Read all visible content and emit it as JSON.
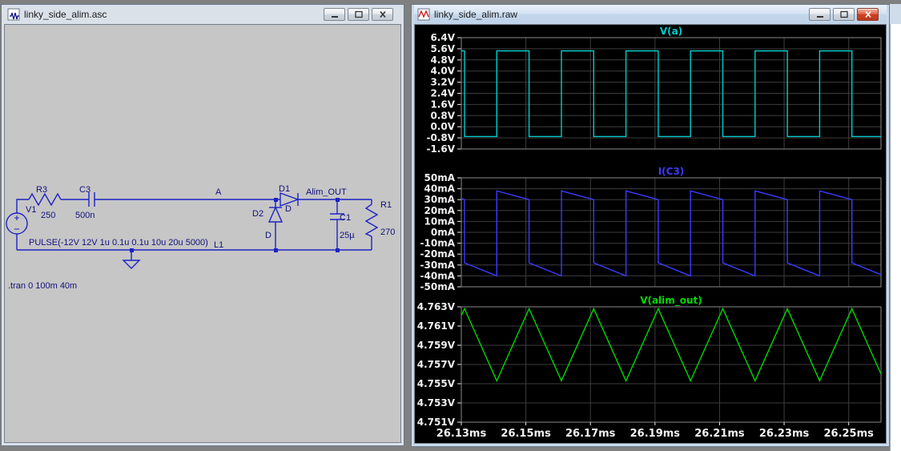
{
  "desktop": {
    "background": "#808080"
  },
  "schematic_window": {
    "title": "linky_side_alim.asc",
    "components": {
      "v1_name": "V1",
      "r3_name": "R3",
      "r3_value": "250",
      "c3_name": "C3",
      "c3_value": "500n",
      "node_a": "A",
      "d2_name": "D2",
      "d2_value": "D",
      "d1_name": "D1",
      "d1_value": "D",
      "node_out": "Alim_OUT",
      "c1_name": "C1",
      "c1_value": "25µ",
      "r1_name": "R1",
      "r1_value": "270",
      "l1_name": "L1",
      "pulse_text": "PULSE(-12V 12V 1u 0.1u 0.1u 10u 20u 5000)",
      "tran_directive": ".tran 0 100m 40m"
    }
  },
  "wave_window": {
    "title": "linky_side_alim.raw"
  },
  "chart_data": [
    {
      "type": "line",
      "title": "V(a)",
      "color": "#00cccc",
      "ylim": [
        -1.6,
        6.4
      ],
      "y_ticks": [
        "6.4V",
        "5.6V",
        "4.8V",
        "4.0V",
        "3.2V",
        "2.4V",
        "1.6V",
        "0.8V",
        "0.0V",
        "-0.8V",
        "-1.6V"
      ],
      "xlim": [
        26.13,
        26.26
      ],
      "x_ticks": [
        26.13,
        26.15,
        26.17,
        26.19,
        26.21,
        26.23,
        26.25
      ],
      "x_tick_labels": [
        "26.13ms",
        "26.15ms",
        "26.17ms",
        "26.19ms",
        "26.21ms",
        "26.23ms",
        "26.25ms"
      ],
      "points": [
        [
          26.13,
          5.45
        ],
        [
          26.131,
          5.45
        ],
        [
          26.131,
          -0.7
        ],
        [
          26.141,
          -0.7
        ],
        [
          26.141,
          5.45
        ],
        [
          26.151,
          5.45
        ],
        [
          26.151,
          -0.7
        ],
        [
          26.161,
          -0.7
        ],
        [
          26.161,
          5.45
        ],
        [
          26.171,
          5.45
        ],
        [
          26.171,
          -0.7
        ],
        [
          26.181,
          -0.7
        ],
        [
          26.181,
          5.45
        ],
        [
          26.191,
          5.45
        ],
        [
          26.191,
          -0.7
        ],
        [
          26.201,
          -0.7
        ],
        [
          26.201,
          5.45
        ],
        [
          26.211,
          5.45
        ],
        [
          26.211,
          -0.7
        ],
        [
          26.221,
          -0.7
        ],
        [
          26.221,
          5.45
        ],
        [
          26.231,
          5.45
        ],
        [
          26.231,
          -0.7
        ],
        [
          26.241,
          -0.7
        ],
        [
          26.241,
          5.45
        ],
        [
          26.251,
          5.45
        ],
        [
          26.251,
          -0.7
        ],
        [
          26.26,
          -0.7
        ]
      ]
    },
    {
      "type": "line",
      "title": "I(C3)",
      "color": "#3b3bff",
      "ylim": [
        -50,
        50
      ],
      "y_ticks": [
        "50mA",
        "40mA",
        "30mA",
        "20mA",
        "10mA",
        "0mA",
        "-10mA",
        "-20mA",
        "-30mA",
        "-40mA",
        "-50mA"
      ],
      "xlim": [
        26.13,
        26.26
      ],
      "x_ticks": [
        26.13,
        26.15,
        26.17,
        26.19,
        26.21,
        26.23,
        26.25
      ],
      "x_tick_labels": [
        "26.13ms",
        "26.15ms",
        "26.17ms",
        "26.19ms",
        "26.21ms",
        "26.23ms",
        "26.25ms"
      ],
      "points": [
        [
          26.13,
          31
        ],
        [
          26.131,
          30
        ],
        [
          26.131,
          -28
        ],
        [
          26.141,
          -40
        ],
        [
          26.141,
          38
        ],
        [
          26.151,
          30
        ],
        [
          26.151,
          -28
        ],
        [
          26.161,
          -40
        ],
        [
          26.161,
          38
        ],
        [
          26.171,
          30
        ],
        [
          26.171,
          -28
        ],
        [
          26.181,
          -40
        ],
        [
          26.181,
          38
        ],
        [
          26.191,
          30
        ],
        [
          26.191,
          -28
        ],
        [
          26.201,
          -40
        ],
        [
          26.201,
          38
        ],
        [
          26.211,
          30
        ],
        [
          26.211,
          -28
        ],
        [
          26.221,
          -40
        ],
        [
          26.221,
          38
        ],
        [
          26.231,
          30
        ],
        [
          26.231,
          -28
        ],
        [
          26.241,
          -40
        ],
        [
          26.241,
          38
        ],
        [
          26.251,
          30
        ],
        [
          26.251,
          -28
        ],
        [
          26.26,
          -38.8
        ]
      ]
    },
    {
      "type": "line",
      "title": "V(alim_out)",
      "color": "#00d800",
      "ylim": [
        4.751,
        4.763
      ],
      "y_ticks": [
        "4.763V",
        "4.761V",
        "4.759V",
        "4.757V",
        "4.755V",
        "4.753V",
        "4.751V"
      ],
      "xlim": [
        26.13,
        26.26
      ],
      "x_ticks": [
        26.13,
        26.15,
        26.17,
        26.19,
        26.21,
        26.23,
        26.25
      ],
      "x_tick_labels": [
        "26.13ms",
        "26.15ms",
        "26.17ms",
        "26.19ms",
        "26.21ms",
        "26.23ms",
        "26.25ms"
      ],
      "points": [
        [
          26.13,
          4.7621
        ],
        [
          26.131,
          4.7628
        ],
        [
          26.141,
          4.7553
        ],
        [
          26.151,
          4.7628
        ],
        [
          26.161,
          4.7553
        ],
        [
          26.171,
          4.7628
        ],
        [
          26.181,
          4.7553
        ],
        [
          26.191,
          4.7628
        ],
        [
          26.201,
          4.7553
        ],
        [
          26.211,
          4.7628
        ],
        [
          26.221,
          4.7553
        ],
        [
          26.231,
          4.7628
        ],
        [
          26.241,
          4.7553
        ],
        [
          26.251,
          4.7628
        ],
        [
          26.26,
          4.756
        ]
      ]
    }
  ]
}
